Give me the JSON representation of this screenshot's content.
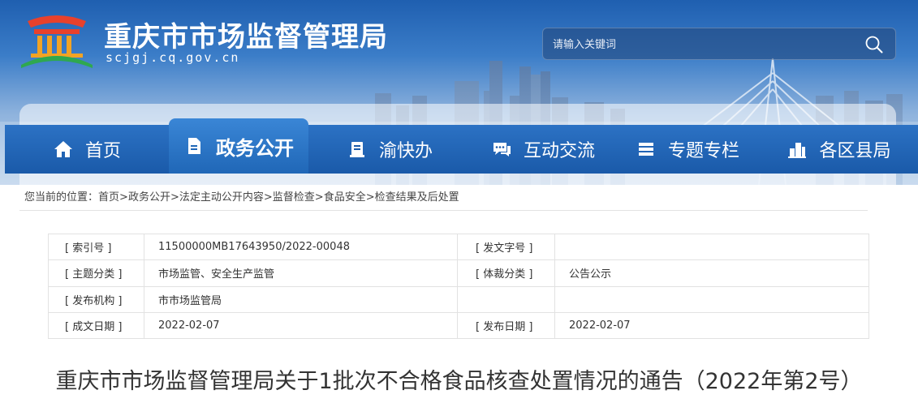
{
  "site": {
    "title": "重庆市市场监督管理局",
    "domain": "scjgj.cq.gov.cn"
  },
  "search": {
    "placeholder": "请输入关键词",
    "icon": "search-icon"
  },
  "nav": {
    "items": [
      {
        "label": "首页",
        "icon": "home-icon",
        "active": false
      },
      {
        "label": "政务公开",
        "icon": "document-icon",
        "active": true
      },
      {
        "label": "渝快办",
        "icon": "book-icon",
        "active": false
      },
      {
        "label": "互动交流",
        "icon": "chat-icon",
        "active": false
      },
      {
        "label": "专题专栏",
        "icon": "layers-icon",
        "active": false
      },
      {
        "label": "各区县局",
        "icon": "buildings-icon",
        "active": false
      }
    ]
  },
  "breadcrumb": {
    "prefix": "您当前的位置：",
    "items": [
      "首页",
      "政务公开",
      "法定主动公开内容",
      "监督检查",
      "食品安全",
      "检查结果及后处置"
    ],
    "separator": ">"
  },
  "meta": {
    "rows": [
      {
        "k1": "[ 索引号 ]",
        "v1": "11500000MB17643950/2022-00048",
        "k2": "[ 发文字号 ]",
        "v2": ""
      },
      {
        "k1": "[ 主题分类 ]",
        "v1": "市场监管、安全生产监管",
        "k2": "[ 体裁分类 ]",
        "v2": "公告公示"
      },
      {
        "k1": "[ 发布机构 ]",
        "v1": "市市场监管局",
        "k2": "",
        "v2": ""
      },
      {
        "k1": "[ 成文日期 ]",
        "v1": "2022-02-07",
        "k2": "[ 发布日期 ]",
        "v2": "2022-02-07"
      }
    ]
  },
  "article": {
    "title": "重庆市市场监督管理局关于1批次不合格食品核查处置情况的通告（2022年第2号）"
  },
  "colors": {
    "nav_blue": "#1a5aa9",
    "nav_active": "#2067b7",
    "banner_sky": "#3b7dc8"
  }
}
